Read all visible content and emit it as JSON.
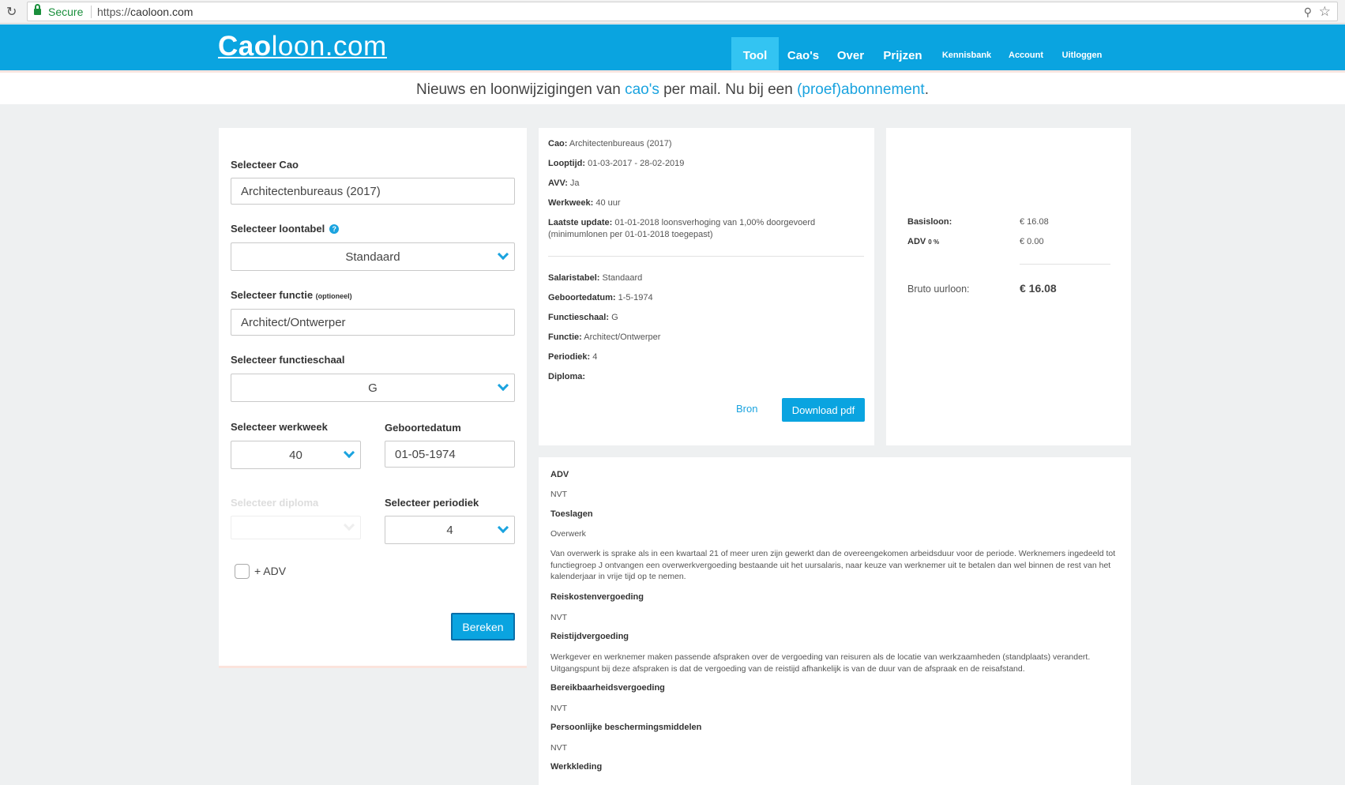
{
  "browser": {
    "secure_label": "Secure",
    "url_scheme": "https://",
    "url_host": "caoloon.com"
  },
  "header": {
    "logo_bold": "Cao",
    "logo_rest": "loon.com",
    "nav": {
      "tool": "Tool",
      "caos": "Cao's",
      "over": "Over",
      "prijzen": "Prijzen",
      "kennisbank": "Kennisbank",
      "account": "Account",
      "uitloggen": "Uitloggen"
    },
    "accent_color": "#0aa4e0"
  },
  "banner": {
    "text1": "Nieuws en loonwijzigingen van ",
    "link1": "cao's",
    "text2": " per mail. Nu bij een ",
    "link2": "(proef)abonnement",
    "text3": "."
  },
  "form": {
    "cao_label": "Selecteer Cao",
    "cao_value": "Architectenbureaus (2017)",
    "loontabel_label": "Selecteer loontabel",
    "loontabel_value": "Standaard",
    "functie_label": "Selecteer functie",
    "functie_optional": "(optioneel)",
    "functie_value": "Architect/Ontwerper",
    "functieschaal_label": "Selecteer functieschaal",
    "functieschaal_value": "G",
    "werkweek_label": "Selecteer werkweek",
    "werkweek_value": "40",
    "geboortedatum_label": "Geboortedatum",
    "geboortedatum_value": "01-05-1974",
    "diploma_label": "Selecteer diploma",
    "periodiek_label": "Selecteer periodiek",
    "periodiek_value": "4",
    "adv_checkbox_label": "+ ADV",
    "submit_label": "Bereken"
  },
  "info": {
    "cao_key": "Cao:",
    "cao_val": " Architectenbureaus (2017)",
    "looptijd_key": "Looptijd:",
    "looptijd_val": " 01-03-2017 - 28-02-2019",
    "avv_key": "AVV:",
    "avv_val": " Ja",
    "werkweek_key": "Werkweek:",
    "werkweek_val": " 40 uur",
    "update_key": "Laatste update:",
    "update_val": " 01-01-2018 loonsverhoging van 1,00% doorgevoerd (minimumlonen per 01-01-2018 toegepast)",
    "salaristabel_key": "Salaristabel:",
    "salaristabel_val": " Standaard",
    "geboortedatum_key": "Geboortedatum:",
    "geboortedatum_val": " 1-5-1974",
    "functieschaal_key": "Functieschaal:",
    "functieschaal_val": " G",
    "functie_key": "Functie:",
    "functie_val": " Architect/Ontwerper",
    "periodiek_key": "Periodiek:",
    "periodiek_val": " 4",
    "diploma_key": "Diploma:",
    "bron_link": "Bron",
    "download_button": "Download pdf"
  },
  "result": {
    "basisloon_label": "Basisloon:",
    "basisloon_value": "€ 16.08",
    "adv_label": "ADV",
    "adv_percent": "0 %",
    "adv_value": "€ 0.00",
    "bruto_label": "Bruto uurloon:",
    "bruto_value": "€ 16.08"
  },
  "details": {
    "adv_head": "ADV",
    "adv_text": "NVT",
    "toeslagen_head": "Toeslagen",
    "overwerk_sub": "Overwerk",
    "overwerk_text": "Van overwerk is sprake als in een kwartaal 21 of meer uren zijn gewerkt dan de overeengekomen arbeidsduur voor de periode. Werknemers ingedeeld tot functiegroep J ontvangen een overwerkvergoeding bestaande uit het uursalaris, naar keuze van werknemer uit te betalen dan wel binnen de rest van het kalenderjaar in vrije tijd op te nemen.",
    "reiskosten_head": "Reiskostenvergoeding",
    "reiskosten_text": "NVT",
    "reistijd_head": "Reistijdvergoeding",
    "reistijd_text": "Werkgever en werknemer maken passende afspraken over de vergoeding van reisuren als de locatie van werkzaamheden (standplaats) verandert. Uitgangspunt bij deze afspraken is dat de vergoeding van de reistijd afhankelijk is van de duur van de afspraak en de reisafstand.",
    "bereikbaarheid_head": "Bereikbaarheidsvergoeding",
    "bereikbaarheid_text": "NVT",
    "bescherming_head": "Persoonlijke beschermingsmiddelen",
    "bescherming_text": "NVT",
    "werkkleding_head": "Werkkleding"
  }
}
